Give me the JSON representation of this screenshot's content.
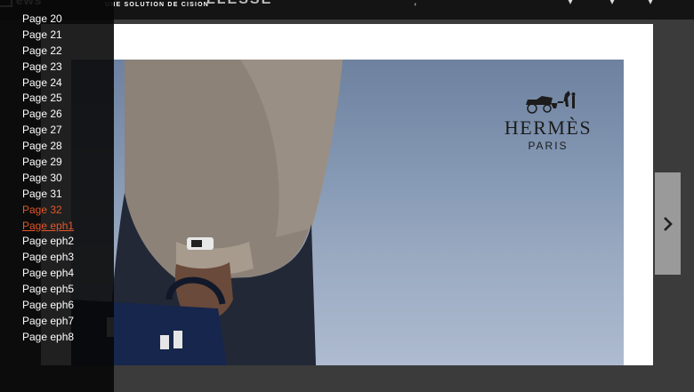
{
  "header": {
    "logo_text": "ews",
    "tagline": "UNE SOLUTION DE CISION",
    "brand_fragment": "LLESSE"
  },
  "sidebar": {
    "items": [
      {
        "label": "Page 20"
      },
      {
        "label": "Page 21"
      },
      {
        "label": "Page 22"
      },
      {
        "label": "Page 23"
      },
      {
        "label": "Page 24"
      },
      {
        "label": "Page 25"
      },
      {
        "label": "Page 26"
      },
      {
        "label": "Page 27"
      },
      {
        "label": "Page 28"
      },
      {
        "label": "Page 29"
      },
      {
        "label": "Page 30"
      },
      {
        "label": "Page 31"
      },
      {
        "label": "Page 32",
        "state": "active"
      },
      {
        "label": "Page eph1",
        "state": "current"
      },
      {
        "label": "Page eph2"
      },
      {
        "label": "Page eph3"
      },
      {
        "label": "Page eph4"
      },
      {
        "label": "Page eph5"
      },
      {
        "label": "Page eph6"
      },
      {
        "label": "Page eph7"
      },
      {
        "label": "Page eph8"
      }
    ]
  },
  "advert": {
    "brand": "HERMÈS",
    "city": "PARIS"
  },
  "navigation": {
    "next_icon": "chevron-right-icon"
  },
  "colors": {
    "active_link": "#e2572b",
    "sidebar_bg": "#080808",
    "viewer_bg": "#3b3b3b"
  }
}
